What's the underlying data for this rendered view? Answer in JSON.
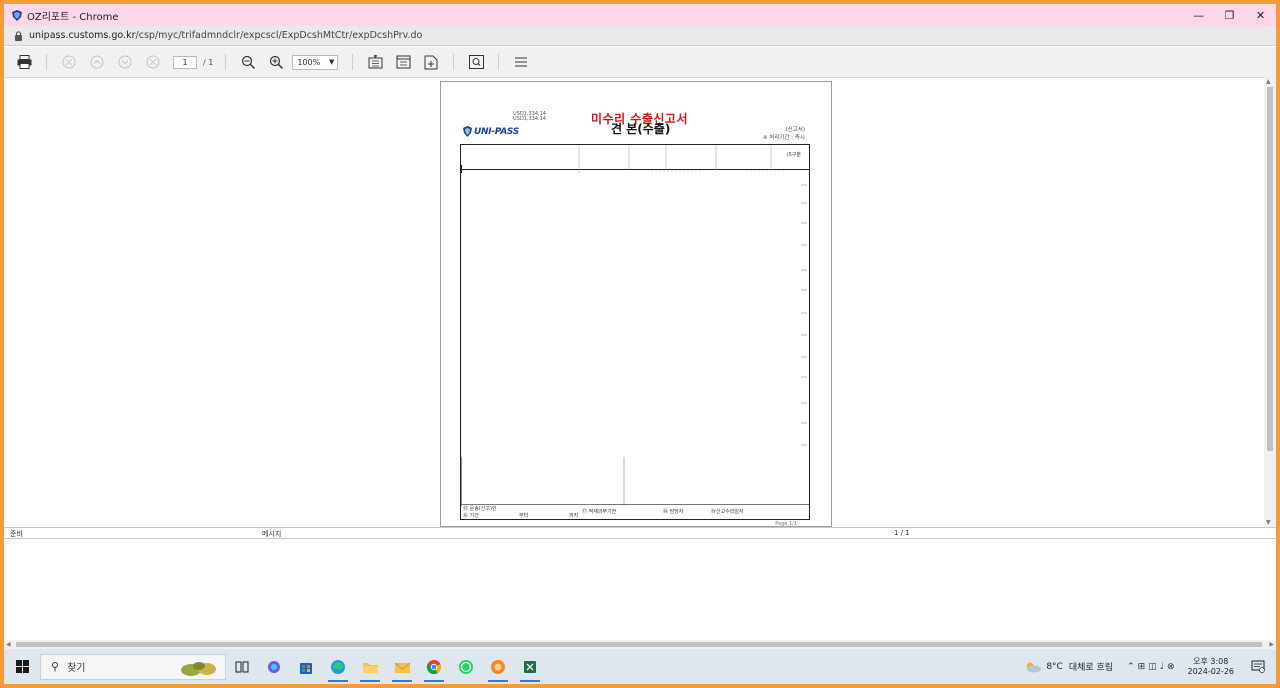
{
  "window": {
    "title": "OZ리포트 - Chrome",
    "url_host": "unipass.customs.go.kr",
    "url_path": "/csp/myc/trifadmndclr/expcscl/ExpDcshMtCtr/expDcshPrv.do"
  },
  "toolbar": {
    "page_current": "1",
    "page_total": "/ 1",
    "zoom": "100%"
  },
  "document": {
    "title_red": "미수리 수출신고서",
    "title_black": "견  본(수출)",
    "usd_line1": "USD1,334.14",
    "usd_line2": "USD1,334.14",
    "logo_text": "UNI-PASS",
    "right_info_line1": "(신고서)",
    "right_info_line2": "※ 처리기간 : 즉시",
    "row1_label": "(5구분",
    "bottom_cells": [
      "⑮ 운송(신고)인",
      "⑯ 기간",
      "부터",
      "까지",
      "⑰ 적재의무기한",
      "⑱ 담당자",
      "⑲신고수리일자"
    ],
    "page_label": "Page    1/1"
  },
  "statusbar": {
    "left": "준비",
    "middle": "메시지",
    "right": "1 / 1"
  },
  "taskbar": {
    "search_placeholder": "찾기",
    "weather_temp": "8°C",
    "weather_text": "대체로 흐림",
    "time": "오후 3:08",
    "date": "2024-02-26"
  }
}
